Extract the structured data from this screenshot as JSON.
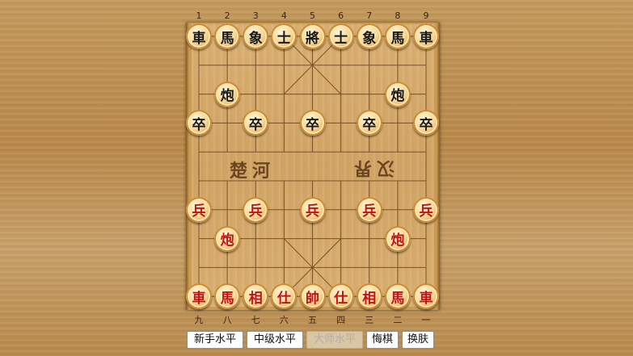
{
  "top_files": [
    "1",
    "2",
    "3",
    "4",
    "5",
    "6",
    "7",
    "8",
    "9"
  ],
  "bottom_files": [
    "九",
    "八",
    "七",
    "六",
    "五",
    "四",
    "三",
    "二",
    "一"
  ],
  "river": {
    "left": "楚河",
    "right": "汉界"
  },
  "black_pieces": [
    {
      "char": "車",
      "file": 0,
      "rank": 0
    },
    {
      "char": "馬",
      "file": 1,
      "rank": 0
    },
    {
      "char": "象",
      "file": 2,
      "rank": 0
    },
    {
      "char": "士",
      "file": 3,
      "rank": 0
    },
    {
      "char": "將",
      "file": 4,
      "rank": 0
    },
    {
      "char": "士",
      "file": 5,
      "rank": 0
    },
    {
      "char": "象",
      "file": 6,
      "rank": 0
    },
    {
      "char": "馬",
      "file": 7,
      "rank": 0
    },
    {
      "char": "車",
      "file": 8,
      "rank": 0
    },
    {
      "char": "炮",
      "file": 1,
      "rank": 2
    },
    {
      "char": "炮",
      "file": 7,
      "rank": 2
    },
    {
      "char": "卒",
      "file": 0,
      "rank": 3
    },
    {
      "char": "卒",
      "file": 2,
      "rank": 3
    },
    {
      "char": "卒",
      "file": 4,
      "rank": 3
    },
    {
      "char": "卒",
      "file": 6,
      "rank": 3
    },
    {
      "char": "卒",
      "file": 8,
      "rank": 3
    }
  ],
  "red_pieces": [
    {
      "char": "兵",
      "file": 0,
      "rank": 6
    },
    {
      "char": "兵",
      "file": 2,
      "rank": 6
    },
    {
      "char": "兵",
      "file": 4,
      "rank": 6
    },
    {
      "char": "兵",
      "file": 6,
      "rank": 6
    },
    {
      "char": "兵",
      "file": 8,
      "rank": 6
    },
    {
      "char": "炮",
      "file": 1,
      "rank": 7
    },
    {
      "char": "炮",
      "file": 7,
      "rank": 7
    },
    {
      "char": "車",
      "file": 0,
      "rank": 9
    },
    {
      "char": "馬",
      "file": 1,
      "rank": 9
    },
    {
      "char": "相",
      "file": 2,
      "rank": 9
    },
    {
      "char": "仕",
      "file": 3,
      "rank": 9
    },
    {
      "char": "帥",
      "file": 4,
      "rank": 9
    },
    {
      "char": "仕",
      "file": 5,
      "rank": 9
    },
    {
      "char": "相",
      "file": 6,
      "rank": 9
    },
    {
      "char": "馬",
      "file": 7,
      "rank": 9
    },
    {
      "char": "車",
      "file": 8,
      "rank": 9
    }
  ],
  "controls": {
    "novice": "新手水平",
    "intermediate": "中级水平",
    "master": "大师水平",
    "master_disabled": true,
    "undo": "悔棋",
    "skin": "换肤"
  }
}
